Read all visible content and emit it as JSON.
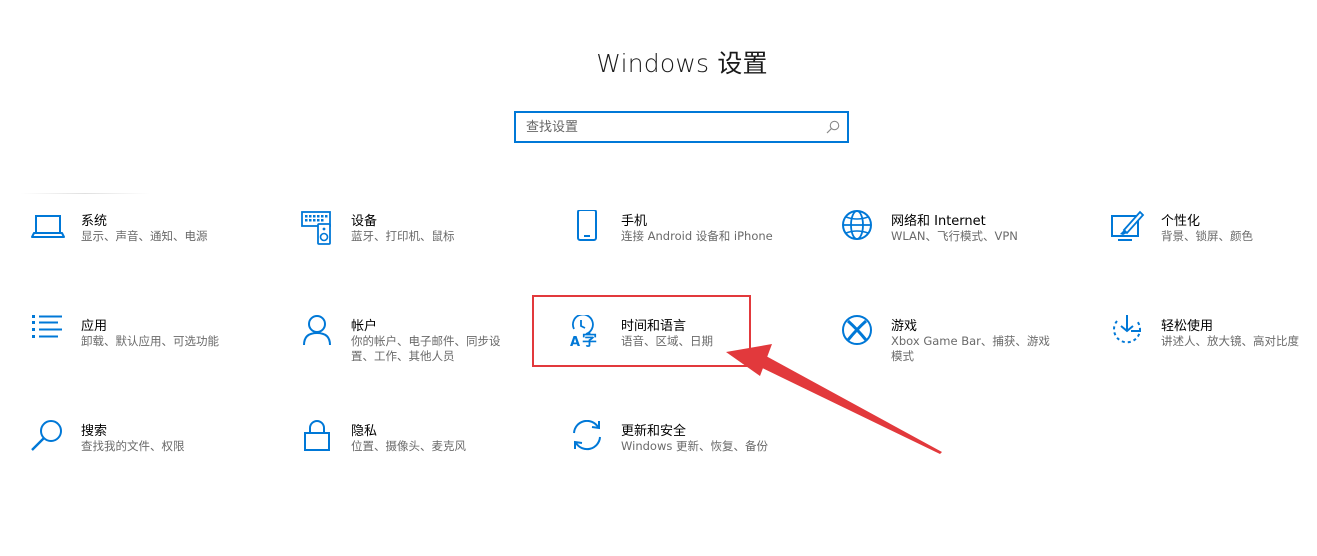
{
  "header": {
    "title": "Windows 设置"
  },
  "search": {
    "placeholder": "查找设置",
    "icon": "search-icon"
  },
  "tiles": [
    {
      "icon": "laptop-icon",
      "title": "系统",
      "subtitle": "显示、声音、通知、电源"
    },
    {
      "icon": "devices-icon",
      "title": "设备",
      "subtitle": "蓝牙、打印机、鼠标"
    },
    {
      "icon": "phone-icon",
      "title": "手机",
      "subtitle": "连接 Android 设备和 iPhone"
    },
    {
      "icon": "globe-icon",
      "title": "网络和 Internet",
      "subtitle": "WLAN、飞行模式、VPN"
    },
    {
      "icon": "personalization-icon",
      "title": "个性化",
      "subtitle": "背景、锁屏、颜色"
    },
    {
      "icon": "apps-list-icon",
      "title": "应用",
      "subtitle": "卸载、默认应用、可选功能"
    },
    {
      "icon": "person-icon",
      "title": "帐户",
      "subtitle": "你的帐户、电子邮件、同步设置、工作、其他人员"
    },
    {
      "icon": "time-language-icon",
      "title": "时间和语言",
      "subtitle": "语音、区域、日期"
    },
    {
      "icon": "xbox-icon",
      "title": "游戏",
      "subtitle": "Xbox Game Bar、捕获、游戏模式"
    },
    {
      "icon": "ease-of-access-icon",
      "title": "轻松使用",
      "subtitle": "讲述人、放大镜、高对比度"
    },
    {
      "icon": "magnifier-icon",
      "title": "搜索",
      "subtitle": "查找我的文件、权限"
    },
    {
      "icon": "lock-icon",
      "title": "隐私",
      "subtitle": "位置、摄像头、麦克风"
    },
    {
      "icon": "sync-icon",
      "title": "更新和安全",
      "subtitle": "Windows 更新、恢复、备份"
    }
  ],
  "colors": {
    "accent": "#0078d7",
    "annotation": "#e2393c"
  }
}
